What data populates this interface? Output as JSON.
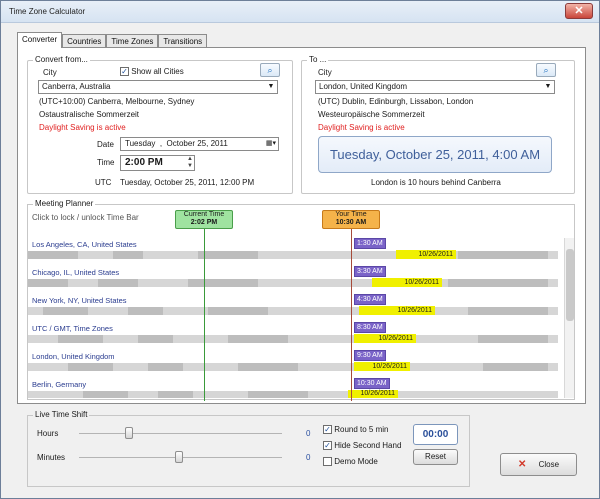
{
  "window": {
    "title": "Time Zone Calculator"
  },
  "tabs": [
    "Converter",
    "Countries",
    "Time Zones",
    "Transitions"
  ],
  "convert_from": {
    "legend": "Convert from...",
    "city_label": "City",
    "show_all_label": "Show all Cities",
    "city_value": "Canberra, Australia",
    "zone_line": "(UTC+10:00) Canberra, Melbourne, Sydney",
    "zone_name": "Ostaustralische Sommerzeit",
    "dst": "Daylight Saving is active",
    "date_label": "Date",
    "date_day": "Tuesday",
    "date_month": "October",
    "date_dayno": "25, 2011",
    "time_label": "Time",
    "time_value": "2:00 PM",
    "utc_label": "UTC",
    "utc_value": "Tuesday, October 25, 2011, 12:00 PM"
  },
  "to": {
    "legend": "To ...",
    "city_label": "City",
    "city_value": "London, United Kingdom",
    "zone_line": "(UTC) Dublin, Edinburgh, Lissabon, London",
    "zone_name": "Westeuropäische Sommerzeit",
    "dst": "Daylight Saving is active",
    "big_time": "Tuesday, October 25, 2011, 4:00 AM",
    "behind": "London is 10 hours behind Canberra"
  },
  "planner": {
    "legend": "Meeting Planner",
    "hint": "Click to lock / unlock Time Bar",
    "current_label": "Current Time",
    "current_time": "2:02 PM",
    "your_label": "Your Time",
    "your_time": "10:30 AM",
    "rows": [
      {
        "city": "Los Angeles, CA, United States",
        "time": "1:30 AM",
        "date": "10/26/2011"
      },
      {
        "city": "Chicago, IL, United States",
        "time": "3:30 AM",
        "date": "10/26/2011"
      },
      {
        "city": "New York, NY, United States",
        "time": "4:30 AM",
        "date": "10/26/2011"
      },
      {
        "city": "UTC / GMT, Time Zones",
        "time": "8:30 AM",
        "date": "10/26/2011"
      },
      {
        "city": "London, United Kingdom",
        "time": "9:30 AM",
        "date": "10/26/2011"
      },
      {
        "city": "Berlin, Germany",
        "time": "10:30 AM",
        "date": "10/26/2011"
      }
    ]
  },
  "live_shift": {
    "legend": "Live Time Shift",
    "hours_label": "Hours",
    "hours_value": "0",
    "minutes_label": "Minutes",
    "minutes_value": "0",
    "round_label": "Round to 5 min",
    "hide_second_label": "Hide Second Hand",
    "demo_label": "Demo Mode",
    "counter": "00:00",
    "reset_label": "Reset"
  },
  "close_label": "Close",
  "colors": {
    "highlight": "#f0f000",
    "time_badge": "#7a63c8",
    "current": "#9fe3a0",
    "your": "#f5b34a",
    "dst": "#e02020"
  }
}
